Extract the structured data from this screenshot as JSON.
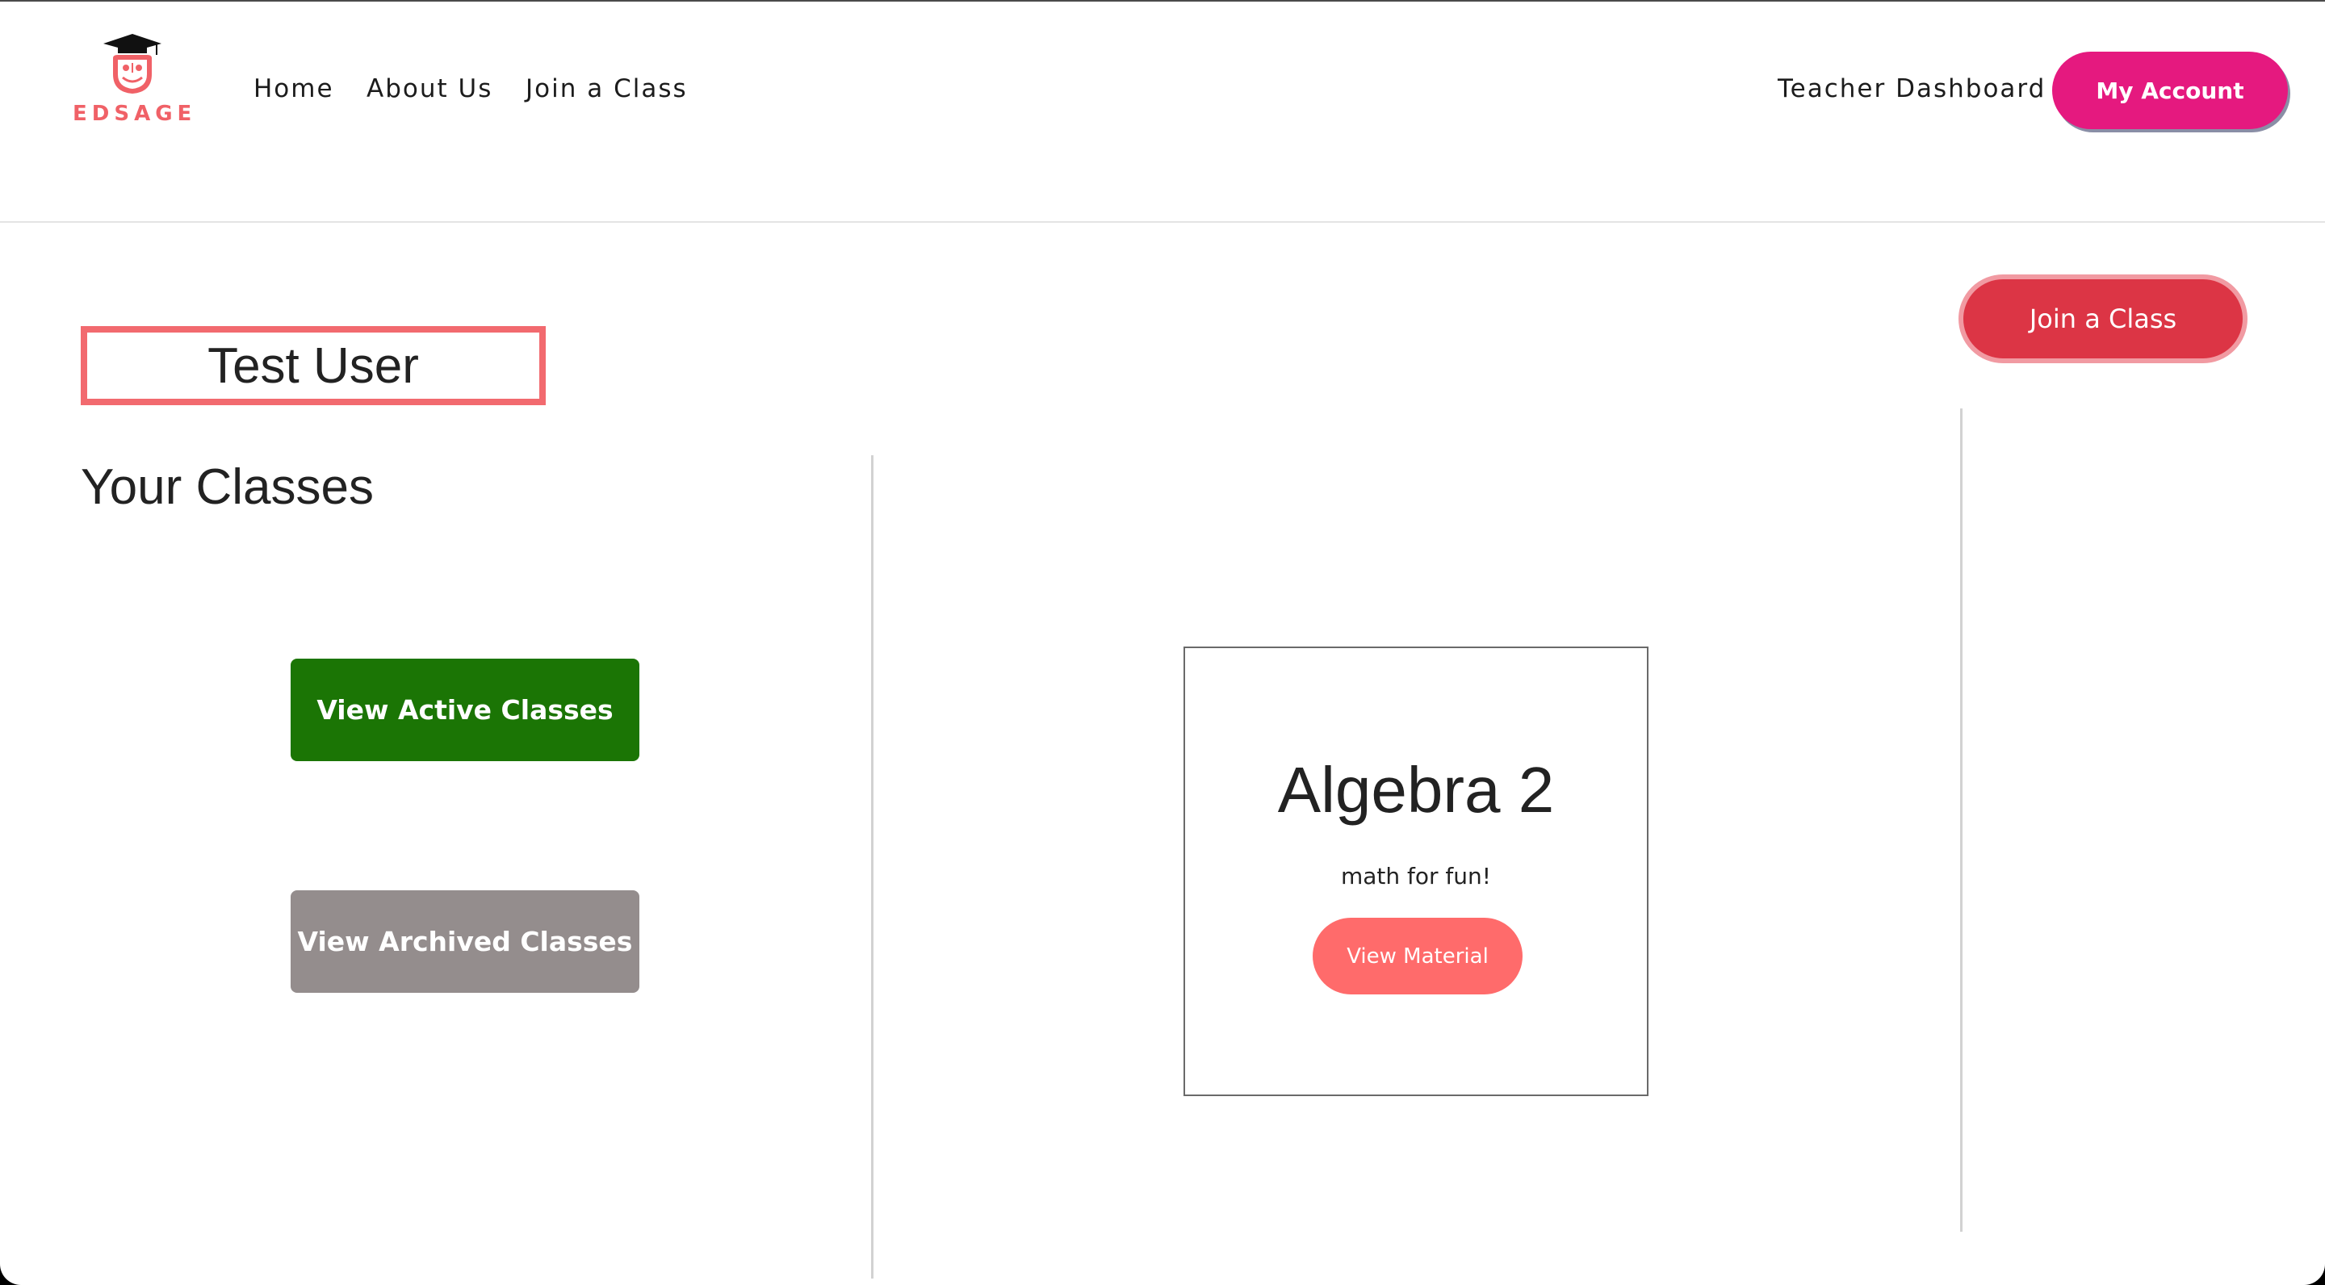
{
  "brand": {
    "name": "EDSAGE",
    "accent": "#f06167"
  },
  "nav": {
    "home": "Home",
    "about": "About Us",
    "join": "Join a Class",
    "teacher_dashboard": "Teacher Dashboard",
    "account_button": "My Account"
  },
  "main": {
    "user_name": "Test User",
    "classes_heading": "Your Classes",
    "active_button": "View Active Classes",
    "archived_button": "View Archived Classes",
    "join_button": "Join a Class"
  },
  "classes": [
    {
      "title": "Algebra 2",
      "description": "math for fun!",
      "action": "View Material"
    }
  ],
  "colors": {
    "account_button": "#e5197f",
    "active_button": "#1b7505",
    "archived_button": "#948d8d",
    "material_button": "#ff6b6b",
    "join_button": "#dc3545",
    "user_box_border": "#f26a6f"
  }
}
